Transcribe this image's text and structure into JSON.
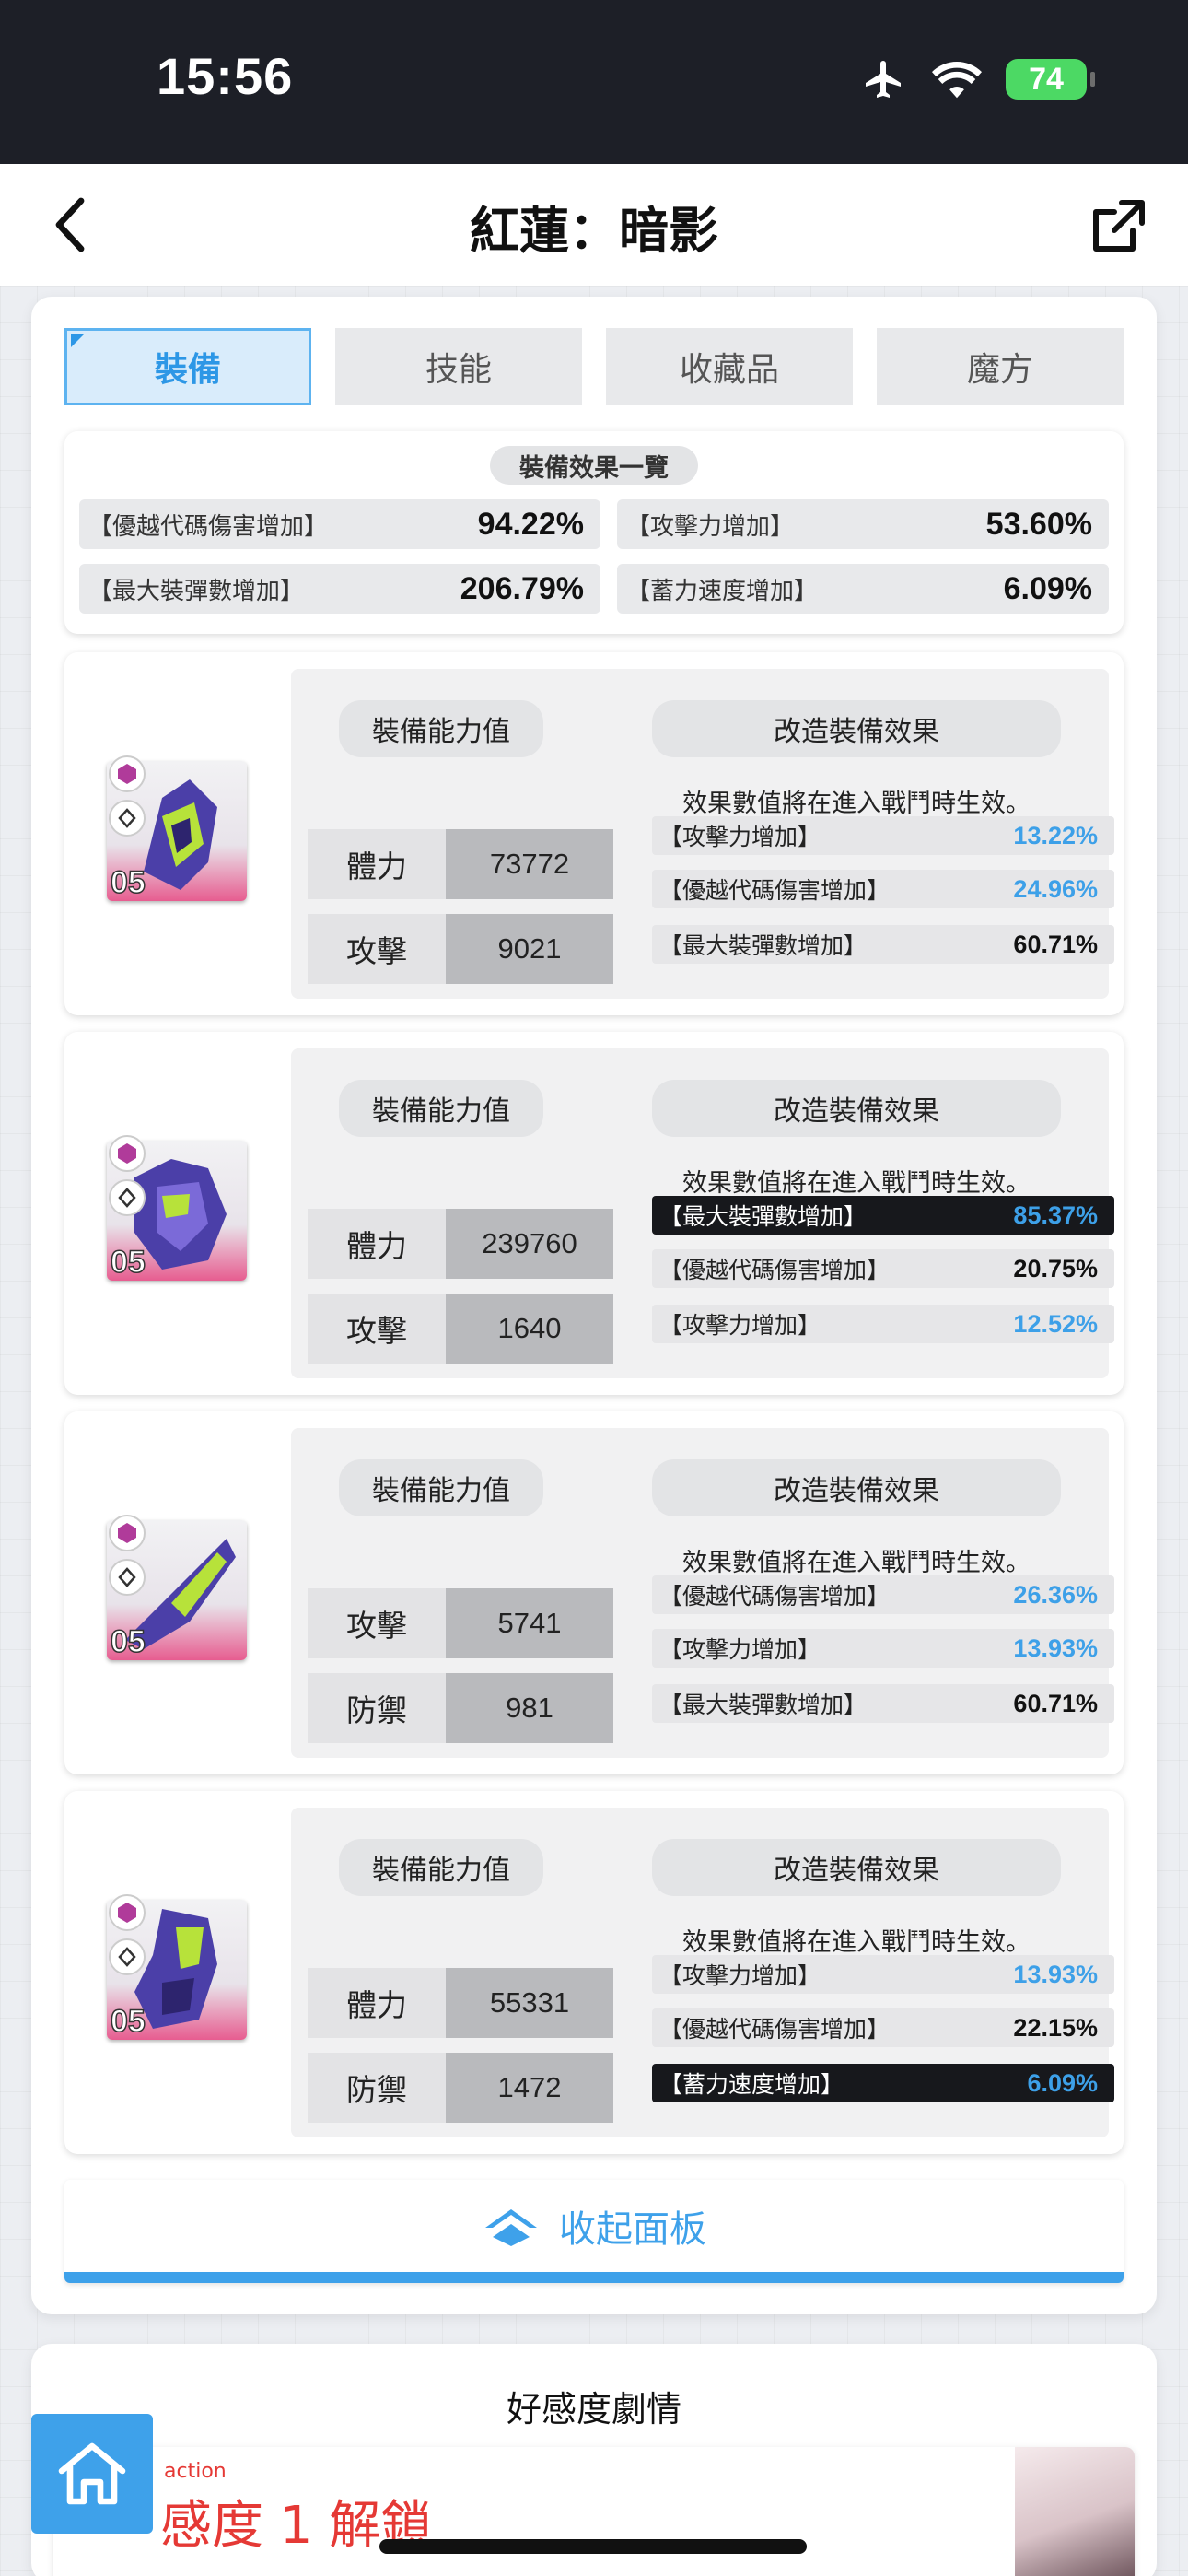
{
  "status_bar": {
    "time": "15:56",
    "battery": "74"
  },
  "nav": {
    "title": "紅蓮：暗影"
  },
  "tabs": [
    "裝備",
    "技能",
    "收藏品",
    "魔方"
  ],
  "summary": {
    "title": "裝備效果一覽",
    "stats": [
      {
        "label": "【優越代碼傷害增加】",
        "value": "94.22%"
      },
      {
        "label": "【攻擊力增加】",
        "value": "53.60%"
      },
      {
        "label": "【最大裝彈數增加】",
        "value": "206.79%"
      },
      {
        "label": "【蓄力速度增加】",
        "value": "6.09%"
      }
    ]
  },
  "equipment_labels": {
    "stats_title": "裝備能力值",
    "effects_title": "改造裝備效果",
    "note": "效果數值將在進入戰鬥時生效。"
  },
  "equipment": [
    {
      "level": "05",
      "stats": [
        {
          "name": "體力",
          "value": "73772"
        },
        {
          "name": "攻擊",
          "value": "9021"
        }
      ],
      "effects": [
        {
          "label": "【攻擊力增加】",
          "value": "13.22%",
          "blue": true,
          "dark": false
        },
        {
          "label": "【優越代碼傷害增加】",
          "value": "24.96%",
          "blue": true,
          "dark": false
        },
        {
          "label": "【最大裝彈數增加】",
          "value": "60.71%",
          "blue": false,
          "dark": false
        }
      ]
    },
    {
      "level": "05",
      "stats": [
        {
          "name": "體力",
          "value": "239760"
        },
        {
          "name": "攻擊",
          "value": "1640"
        }
      ],
      "effects": [
        {
          "label": "【最大裝彈數增加】",
          "value": "85.37%",
          "blue": true,
          "dark": true
        },
        {
          "label": "【優越代碼傷害增加】",
          "value": "20.75%",
          "blue": false,
          "dark": false
        },
        {
          "label": "【攻擊力增加】",
          "value": "12.52%",
          "blue": true,
          "dark": false
        }
      ]
    },
    {
      "level": "05",
      "stats": [
        {
          "name": "攻擊",
          "value": "5741"
        },
        {
          "name": "防禦",
          "value": "981"
        }
      ],
      "effects": [
        {
          "label": "【優越代碼傷害增加】",
          "value": "26.36%",
          "blue": true,
          "dark": false
        },
        {
          "label": "【攻擊力增加】",
          "value": "13.93%",
          "blue": true,
          "dark": false
        },
        {
          "label": "【最大裝彈數增加】",
          "value": "60.71%",
          "blue": false,
          "dark": false
        }
      ]
    },
    {
      "level": "05",
      "stats": [
        {
          "name": "體力",
          "value": "55331"
        },
        {
          "name": "防禦",
          "value": "1472"
        }
      ],
      "effects": [
        {
          "label": "【攻擊力增加】",
          "value": "13.93%",
          "blue": true,
          "dark": false
        },
        {
          "label": "【優越代碼傷害增加】",
          "value": "22.15%",
          "blue": false,
          "dark": false
        },
        {
          "label": "【蓄力速度增加】",
          "value": "6.09%",
          "blue": true,
          "dark": true
        }
      ]
    }
  ],
  "collapse": {
    "label": "收起面板"
  },
  "bottom": {
    "title": "好感度劇情",
    "tag": "action",
    "unlock_text": "感度 1 解鎖"
  },
  "colors": {
    "accent": "#3ea1ea",
    "highlight_value": "#3da0e8",
    "dark_row": "#17181c"
  },
  "icons": [
    "back-arrow-icon",
    "share-icon",
    "airplane-icon",
    "wifi-icon",
    "battery-icon",
    "home-icon",
    "double-chevron-up-icon"
  ]
}
